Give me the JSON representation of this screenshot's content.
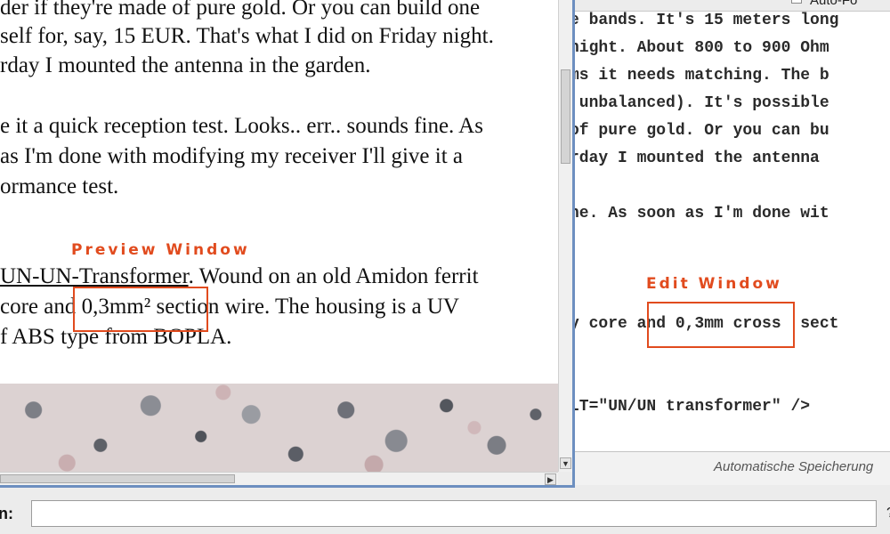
{
  "edit_window": {
    "autoformat_label": "Auto-Fo",
    "lines": [
      "e bands. It's 15 meters long",
      "night. About 800 to 900 Ohm",
      "ms it needs matching. The b",
      " unbalanced). It's possible",
      "of pure gold. Or you can bu",
      "rday I mounted the antenna ",
      "",
      "ne. As soon as I'm done wit",
      "",
      "",
      "",
      "y core and 0,3mm cross  sect",
      "",
      "",
      "LT=\"UN/UN transformer\" />"
    ],
    "status_text": "Automatische Speicherung"
  },
  "preview_window": {
    "paragraph1": [
      "der if they're made of pure gold. Or you can build one",
      "self for, say, 15 EUR. That's what I did on Friday night.",
      "rday I mounted the antenna in the garden."
    ],
    "paragraph2": [
      "e it a quick reception test. Looks.. err.. sounds fine. As",
      " as I'm done with modifying my receiver I'll give it a",
      "ormance test."
    ],
    "paragraph3": {
      "link_text": "UN-UN-Transformer",
      "line1_rest": ". Wound on an old Amidon ferrit",
      "line2": "core and 0,3mm² section wire. The housing is a UV",
      "line3": "f ABS type from BOPLA."
    },
    "image_icon": "granite-texture-image",
    "scroll_down_icon": "arrow-down-icon",
    "scroll_right_icon": "arrow-right-icon"
  },
  "annotations": {
    "preview_label": "Preview Window",
    "edit_label": "Edit Window",
    "color": "#e14b1e"
  },
  "bottom_bar": {
    "label": "n:",
    "input_value": "",
    "right_char": "?"
  }
}
